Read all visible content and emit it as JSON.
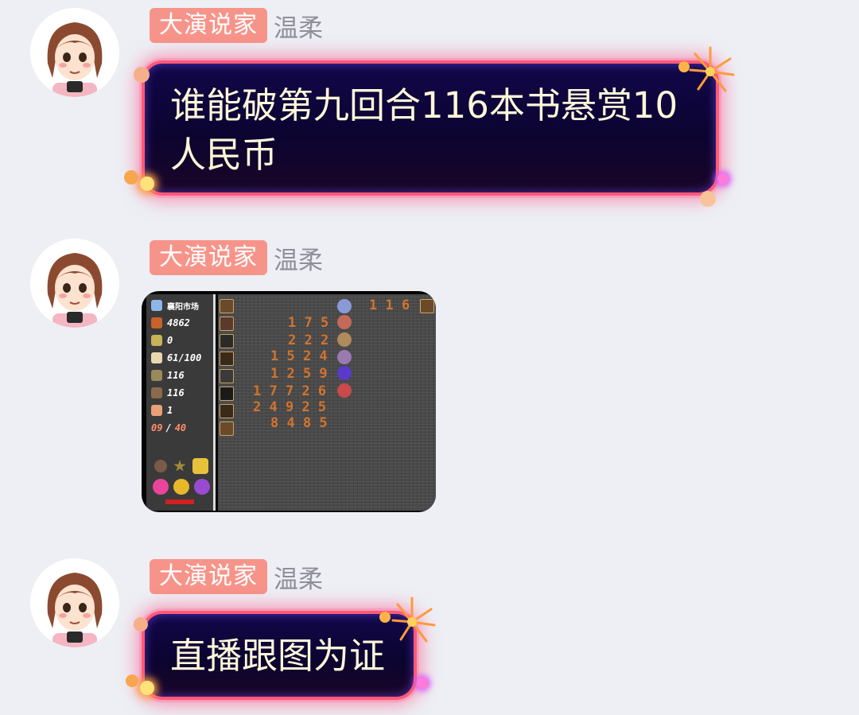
{
  "messages": [
    {
      "badge": "大演说家",
      "nickname": "温柔",
      "type": "text",
      "text": "谁能破第九回合116本书悬赏10\n人民币"
    },
    {
      "badge": "大演说家",
      "nickname": "温柔",
      "type": "image",
      "image": {
        "location": "襄阳市场",
        "stats": [
          "4862",
          "0",
          "61/100",
          "116",
          "116",
          "1"
        ],
        "round": "09",
        "round_sep": "/",
        "round_total": "40",
        "top_number": "1 1 6",
        "grid_rows": [
          "1 7 5",
          "2 2 2",
          "1 5 2 4",
          "1 2 5 9",
          "1 7 7 2 6",
          "2 4 9 2 5",
          "8 4 8 5"
        ]
      }
    },
    {
      "badge": "大演说家",
      "nickname": "温柔",
      "type": "text",
      "text": "直播跟图为证"
    }
  ],
  "colors": {
    "background": "#edeff5",
    "badge": "#f7948a",
    "nickname": "#8e8f99",
    "bubble_text": "#fff6d8",
    "bubble_border": "#ff5a78",
    "grid_number": "#d2742f"
  },
  "icons": [
    "avatar",
    "firework-icon",
    "sparkle-icon"
  ]
}
